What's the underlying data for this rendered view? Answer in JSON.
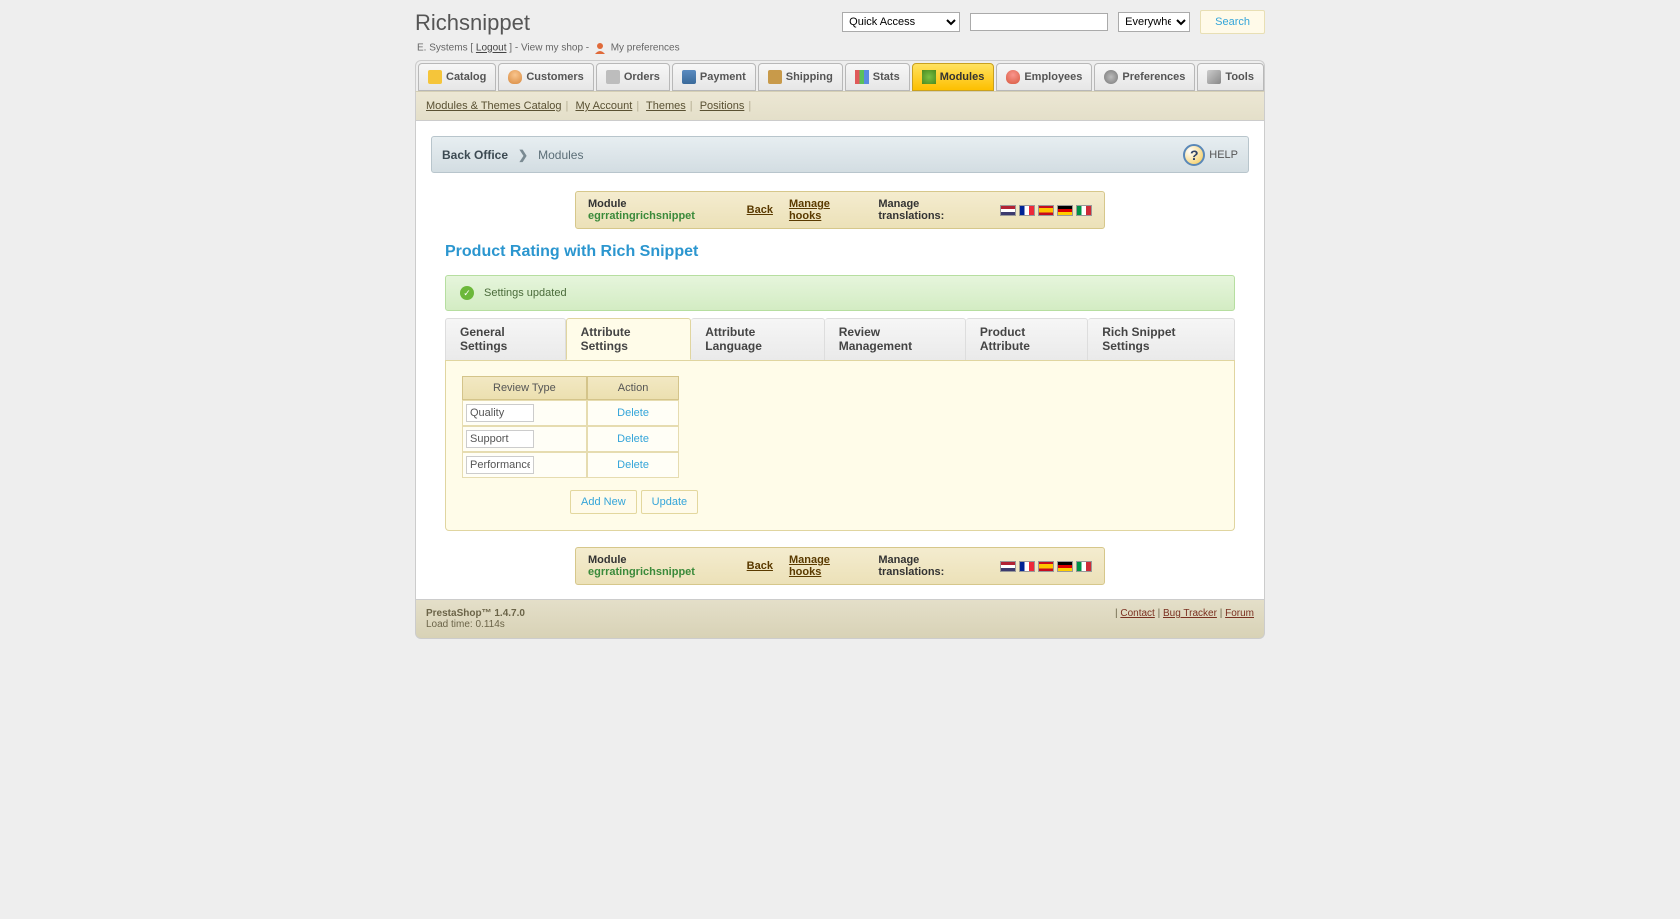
{
  "header": {
    "title": "Richsnippet",
    "quick_access": "Quick Access",
    "search_scope": "Everywhere",
    "search_btn": "Search",
    "userline_prefix": "E. Systems [ ",
    "logout": "Logout",
    "userline_mid": " ] - View my shop - ",
    "my_prefs": "My preferences"
  },
  "nav": {
    "items": [
      {
        "label": "Catalog",
        "icon": "ic-catalog"
      },
      {
        "label": "Customers",
        "icon": "ic-customers"
      },
      {
        "label": "Orders",
        "icon": "ic-orders"
      },
      {
        "label": "Payment",
        "icon": "ic-payment"
      },
      {
        "label": "Shipping",
        "icon": "ic-shipping"
      },
      {
        "label": "Stats",
        "icon": "ic-stats"
      },
      {
        "label": "Modules",
        "icon": "ic-modules"
      },
      {
        "label": "Employees",
        "icon": "ic-employees"
      },
      {
        "label": "Preferences",
        "icon": "ic-preferences"
      },
      {
        "label": "Tools",
        "icon": "ic-tools"
      }
    ]
  },
  "subnav": {
    "items": [
      "Modules & Themes Catalog",
      "My Account",
      "Themes",
      "Positions"
    ]
  },
  "breadcrumb": {
    "root": "Back Office",
    "current": "Modules",
    "help": "HELP"
  },
  "modulebar": {
    "module_label": "Module",
    "module_name": "egrratingrichsnippet",
    "back": "Back",
    "manage_hooks": "Manage hooks",
    "manage_translations": "Manage translations:"
  },
  "section_title": "Product Rating with Rich Snippet",
  "success_msg": "Settings updated",
  "tabs": [
    "General Settings",
    "Attribute Settings",
    "Attribute Language",
    "Review Management",
    "Product Attribute",
    "Rich Snippet Settings"
  ],
  "attr_table": {
    "headers": [
      "Review Type",
      "Action"
    ],
    "rows": [
      {
        "name": "Quality",
        "action": "Delete"
      },
      {
        "name": "Support",
        "action": "Delete"
      },
      {
        "name": "Performance",
        "action": "Delete"
      }
    ],
    "add_new": "Add New",
    "update": "Update"
  },
  "footer": {
    "version": "PrestaShop™ 1.4.7.0",
    "loadtime": "Load time: 0.114s",
    "links": [
      "Contact",
      "Bug Tracker",
      "Forum"
    ]
  }
}
